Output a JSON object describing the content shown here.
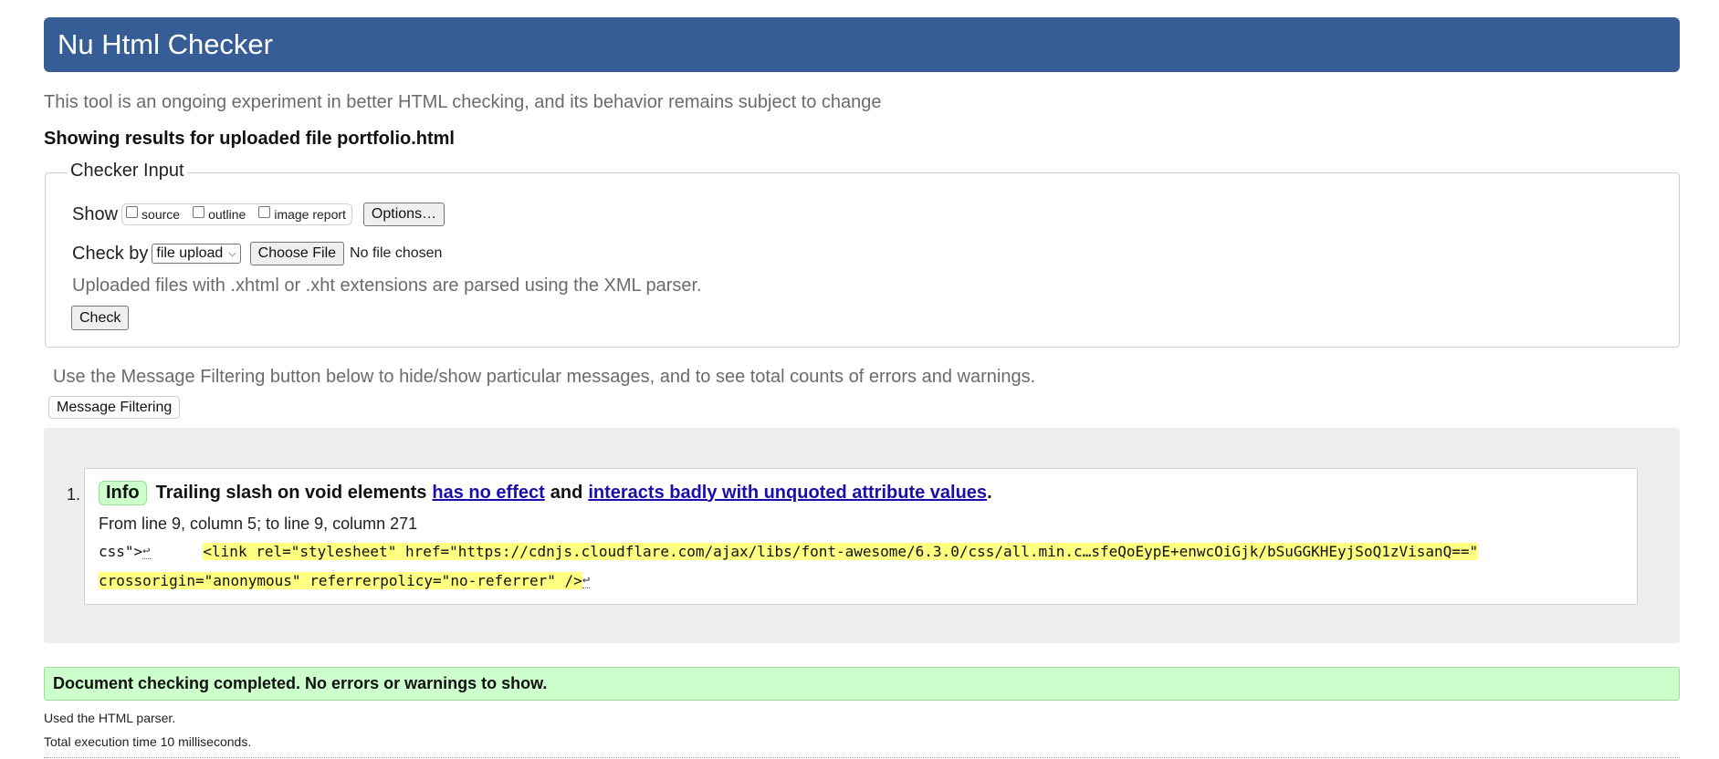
{
  "header": {
    "title": "Nu Html Checker"
  },
  "tagline": "This tool is an ongoing experiment in better HTML checking, and its behavior remains subject to change",
  "showing_results": "Showing results for uploaded file portfolio.html",
  "checker_input": {
    "legend": "Checker Input",
    "show_label": "Show",
    "show_options": [
      {
        "label": "source",
        "checked": false
      },
      {
        "label": "outline",
        "checked": false
      },
      {
        "label": "image report",
        "checked": false
      }
    ],
    "options_button": "Options…",
    "check_by_label": "Check by",
    "check_by_selected": "file upload",
    "choose_file_button": "Choose File",
    "no_file_text": "No file chosen",
    "xml_note": "Uploaded files with .xhtml or .xht extensions are parsed using the XML parser.",
    "check_button": "Check"
  },
  "filtering": {
    "note": "Use the Message Filtering button below to hide/show particular messages, and to see total counts of errors and warnings.",
    "button": "Message Filtering"
  },
  "messages": [
    {
      "number": "1.",
      "type": "Info",
      "text_before": "Trailing slash on void elements",
      "link1": "has no effect",
      "text_middle": "and",
      "link2": "interacts badly with unquoted attribute values",
      "text_after": ".",
      "location": "From line 9, column 5; to line 9, column 271",
      "code_prefix": "css\">",
      "code_highlight_line1": "<link rel=\"stylesheet\" href=\"https://cdnjs.cloudflare.com/ajax/libs/font-awesome/6.3.0/css/all.min.c…sfeQoEypE+enwcOiGjk/bSuGGKHEyjSoQ1zVisanQ==\"",
      "code_highlight_line2": "crossorigin=\"anonymous\" referrerpolicy=\"no-referrer\" />",
      "return_symbol": "↩"
    }
  ],
  "status": {
    "success": "Document checking completed. No errors or warnings to show.",
    "parser": "Used the HTML parser.",
    "execution_time": "Total execution time 10 milliseconds."
  },
  "colors": {
    "header_bg": "#365d95",
    "info_badge_bg": "#ccffcc",
    "highlight": "#ffff80",
    "link": "#1a0dab"
  }
}
